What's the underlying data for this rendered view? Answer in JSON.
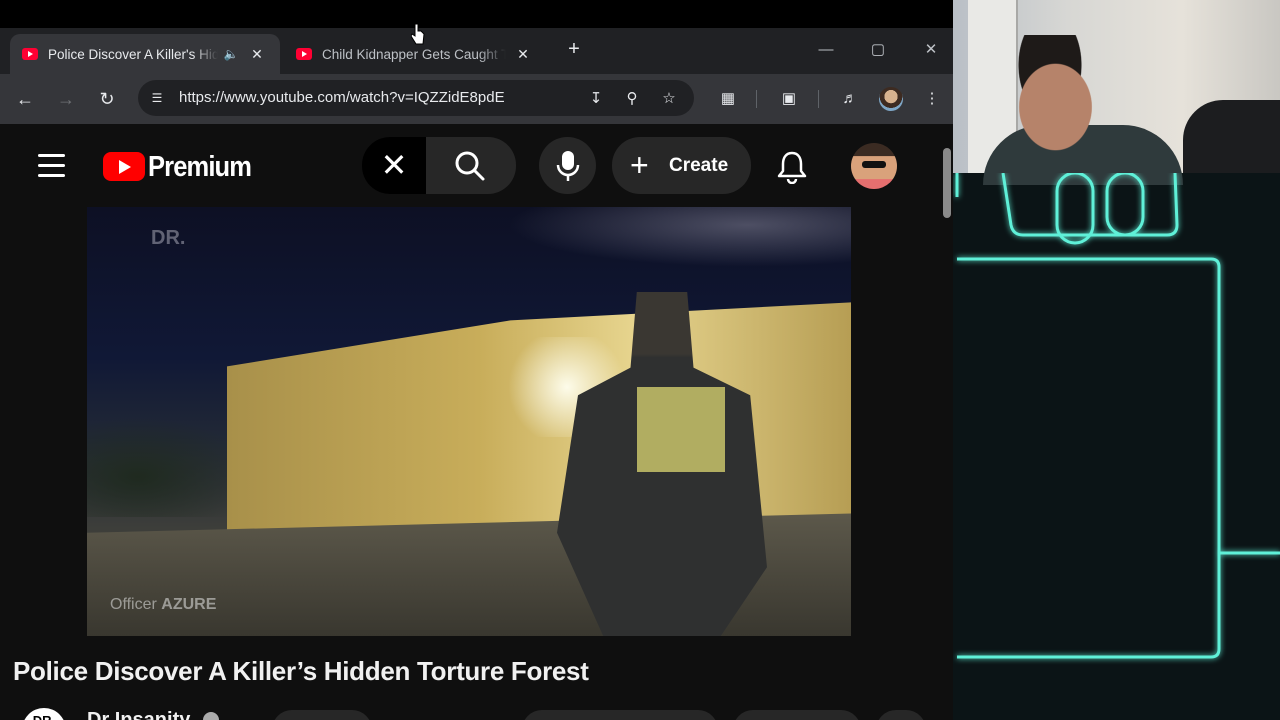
{
  "browser": {
    "tabs": [
      {
        "title": "Police Discover A Killer's Hidden Torture Forest",
        "active": true,
        "audio": true
      },
      {
        "title": "Child Kidnapper Gets Caught Trying",
        "active": false,
        "audio": false
      }
    ],
    "url": "https://www.youtube.com/watch?v=IQZZidE8pdE"
  },
  "youtube": {
    "brand": "Premium",
    "create_label": "Create",
    "video": {
      "title": "Police Discover A Killer’s Hidden Torture Forest",
      "channel": "Dr Insanity",
      "watermark_top": "DR.",
      "watermark_bottom_prefix": "Officer",
      "watermark_bottom_name": "AZURE"
    },
    "channel_avatar_text": "DR."
  },
  "colors": {
    "yt_red": "#ff0000",
    "neon_cyan": "#5ff0d8",
    "page_bg": "#0f0f0f"
  },
  "icons": [
    "back-icon",
    "forward-icon",
    "reload-icon",
    "site-info-icon",
    "install-icon",
    "zoom-icon",
    "star-icon",
    "extensions-icon",
    "reading-list-icon",
    "media-controls-icon",
    "kebab-menu-icon",
    "search-icon",
    "mic-icon",
    "bell-icon",
    "close-icon"
  ]
}
